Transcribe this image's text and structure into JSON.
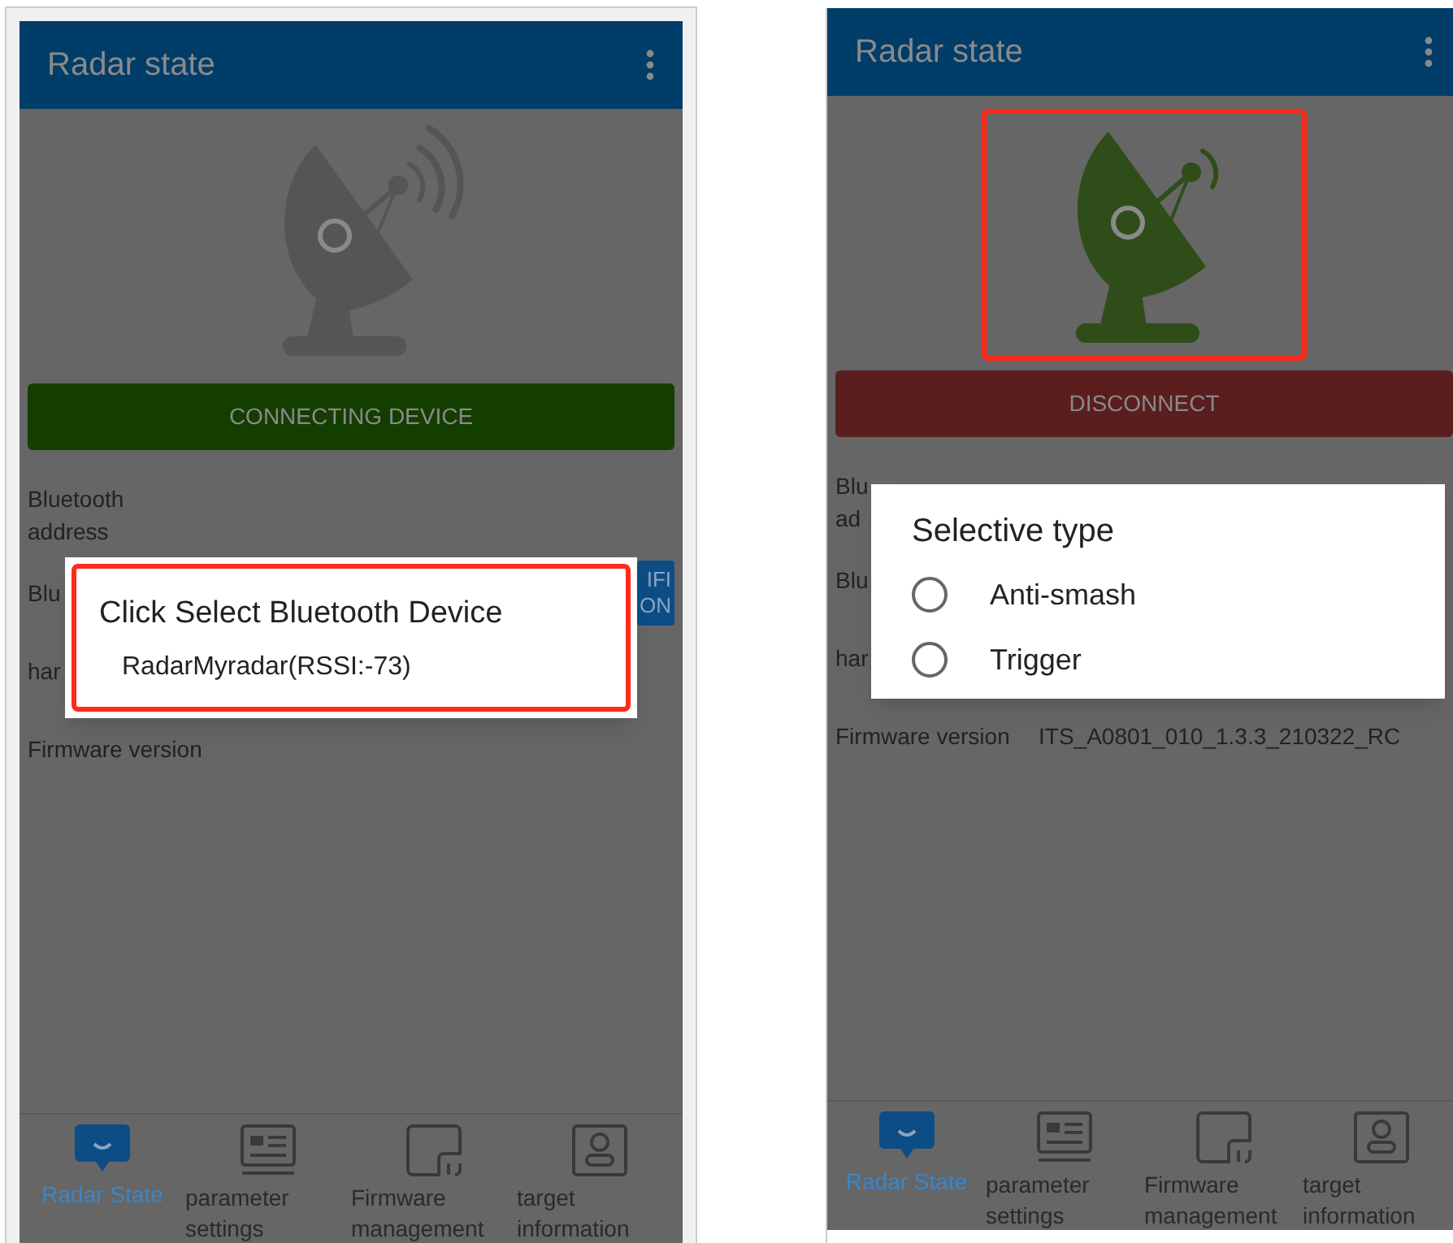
{
  "screens": [
    {
      "title": "Radar state",
      "antenna": {
        "connected": false,
        "highlighted": false
      },
      "action": {
        "label": "CONNECTING DEVICE",
        "kind": "connect"
      },
      "fields": [
        {
          "lines": [
            "Bluetooth",
            "address"
          ]
        },
        {
          "lines": [
            "Blu"
          ],
          "side_button": [
            "IFI",
            "ON"
          ]
        },
        {
          "lines": [
            "har"
          ]
        },
        {
          "lines": [
            "Firmware version"
          ]
        }
      ],
      "dialog": {
        "kind": "device_list",
        "title": "Click Select Bluetooth Device",
        "highlighted": true,
        "items": [
          "RadarMyradar(RSSI:-73)"
        ]
      },
      "nav": [
        {
          "kind": "radar",
          "label": "Radar State",
          "selected": true
        },
        {
          "kind": "parameters",
          "label": "parameter settings",
          "selected": false
        },
        {
          "kind": "firmware",
          "label": "Firmware management",
          "selected": false
        },
        {
          "kind": "target",
          "label": "target information",
          "selected": false
        }
      ]
    },
    {
      "title": "Radar state",
      "antenna": {
        "connected": true,
        "highlighted": true
      },
      "action": {
        "label": "DISCONNECT",
        "kind": "disconnect"
      },
      "fields": [
        {
          "lines": [
            "Blu",
            "ad"
          ]
        },
        {
          "lines": [
            "Blu"
          ]
        },
        {
          "lines": [
            "har"
          ]
        },
        {
          "lines": [
            "Firmware version"
          ],
          "value": "ITS_A0801_010_1.3.3_210322_RC"
        }
      ],
      "dialog": {
        "kind": "radio_list",
        "title": "Selective type",
        "options": [
          {
            "label": "Anti-smash",
            "selected": false
          },
          {
            "label": "Trigger",
            "selected": false
          }
        ]
      },
      "nav": [
        {
          "kind": "radar",
          "label": "Radar State",
          "selected": true
        },
        {
          "kind": "parameters",
          "label": "parameter settings",
          "selected": false
        },
        {
          "kind": "firmware",
          "label": "Firmware management",
          "selected": false
        },
        {
          "kind": "target",
          "label": "target information",
          "selected": false
        }
      ]
    }
  ]
}
